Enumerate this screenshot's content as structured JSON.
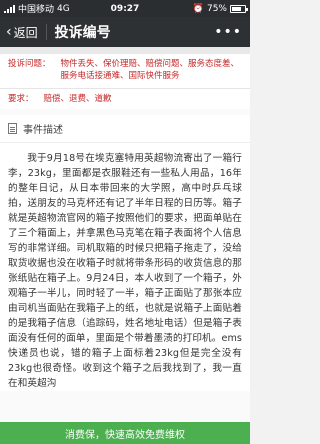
{
  "status_bar": {
    "carrier": "中国移动",
    "network": "4G",
    "time": "09:27",
    "battery": "75%",
    "battery_level": 0.75
  },
  "navbar": {
    "back_label": "返回",
    "title": "投诉编号",
    "more_icon": "more-dots-icon"
  },
  "info": {
    "complaint_label": "投诉问题：",
    "complaint_value": "物件丢失、保价理赔、赔偿问题、服务态度差、服务电话接通难、国际快件服务",
    "demand_label": "要求：",
    "demand_value": "赔偿、退费、道歉"
  },
  "section": {
    "title": "事件描述"
  },
  "description": "我于9月18号在埃克塞特用英超物流寄出了一箱行李，23kg，里面都是衣服鞋还有一些私人用品，16年的整年日记，从日本带回来的大学照，高中时乒乓球拍，送朋友的马克杯还有记了半年日程的日历等。箱子就是英超物流官网的箱子按照他们的要求，把面单贴在了三个箱面上，并拿黑色马克笔在箱子表面将个人信息写的非常详细。司机取箱的时候只把箱子拖走了，没给取货收据也没在收箱子时就将带条形码的收货信息的那张纸贴在箱子上。9月24日，本人收到了一个箱子，外观箱子一半儿，同时轻了一半，箱子正面贴了那张本应由司机当面贴在我箱子上的纸，也就是说箱子上面贴着的是我箱子信息（追踪码，姓名地址电话）但是箱子表面没有任何的面单，里面是个带着墨渍的打印机。ems快递员也说，错的箱子上面标着23kg但是完全没有23kg也很奇怪。收到这个箱子之后我找到了，我一直在和英超沟",
  "cta": {
    "label": "消费保，快速高效免费维权"
  }
}
